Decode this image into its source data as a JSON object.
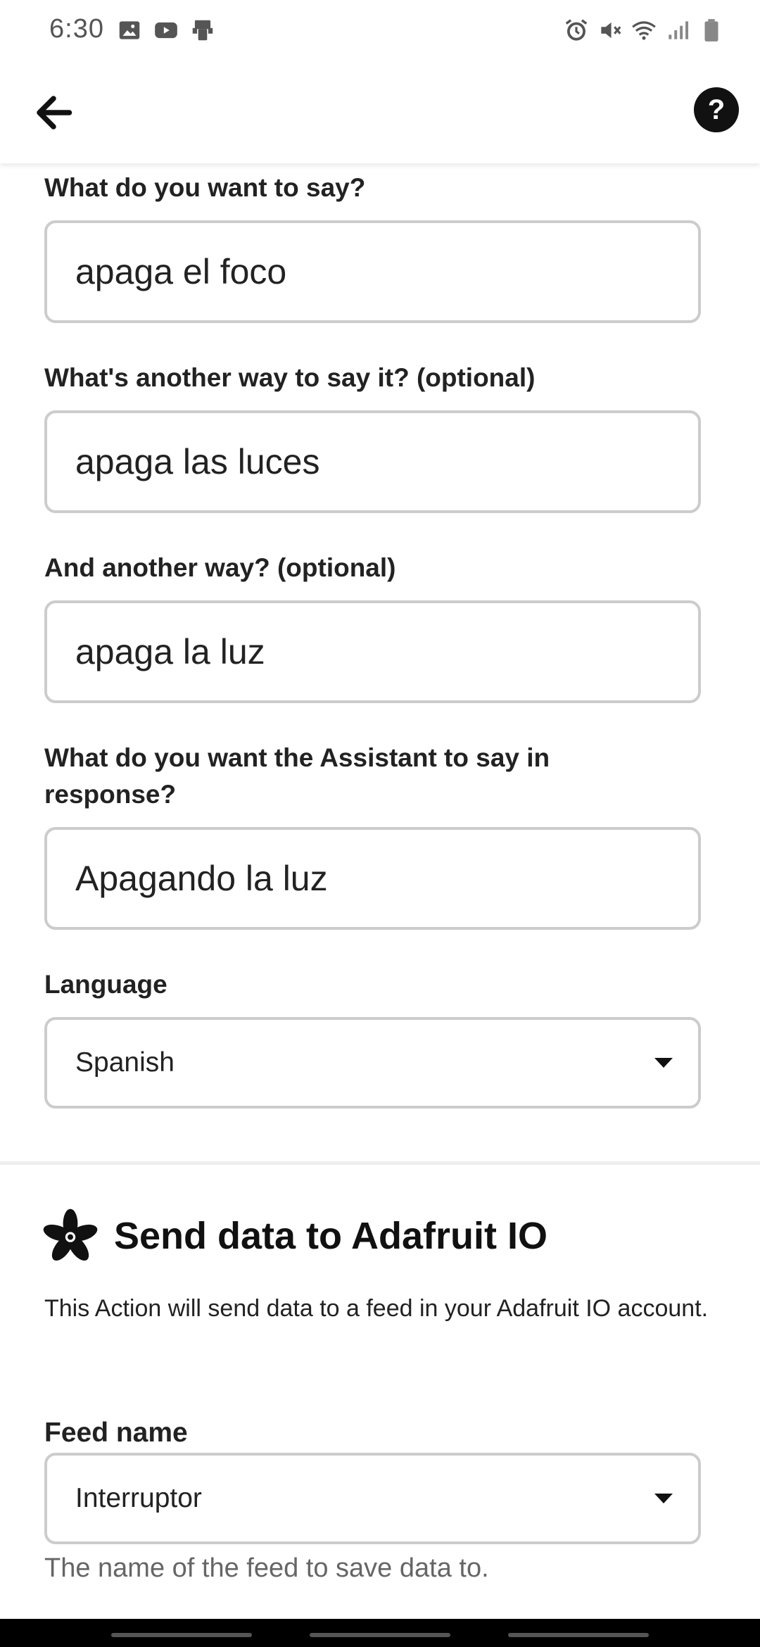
{
  "status_bar": {
    "time": "6:30",
    "left_icons": [
      "image-icon",
      "youtube-icon",
      "app-icon"
    ],
    "right_icons": [
      "alarm-icon",
      "mute-icon",
      "wifi-icon",
      "signal-icon",
      "battery-icon"
    ]
  },
  "header": {
    "back_icon": "arrow-left-icon",
    "help_label": "?"
  },
  "form": {
    "phrase1": {
      "label": "What do you want to say?",
      "value": "apaga el foco"
    },
    "phrase2": {
      "label": "What's another way to say it? (optional)",
      "value": "apaga las luces"
    },
    "phrase3": {
      "label": "And another way? (optional)",
      "value": "apaga la luz"
    },
    "response": {
      "label": "What do you want the Assistant to say in response?",
      "value": "Apagando la luz"
    },
    "language": {
      "label": "Language",
      "value": "Spanish"
    }
  },
  "action": {
    "icon": "adafruit-flower-icon",
    "title": "Send data to Adafruit IO",
    "description": "This Action will send data to a feed in your Adafruit IO account.",
    "feed": {
      "label": "Feed name",
      "value": "Interruptor",
      "helper": "The name of the feed to save data to."
    }
  },
  "colors": {
    "border": "#cccccc",
    "text": "#222222",
    "helper": "#666666",
    "nav_bar": "#000000"
  }
}
